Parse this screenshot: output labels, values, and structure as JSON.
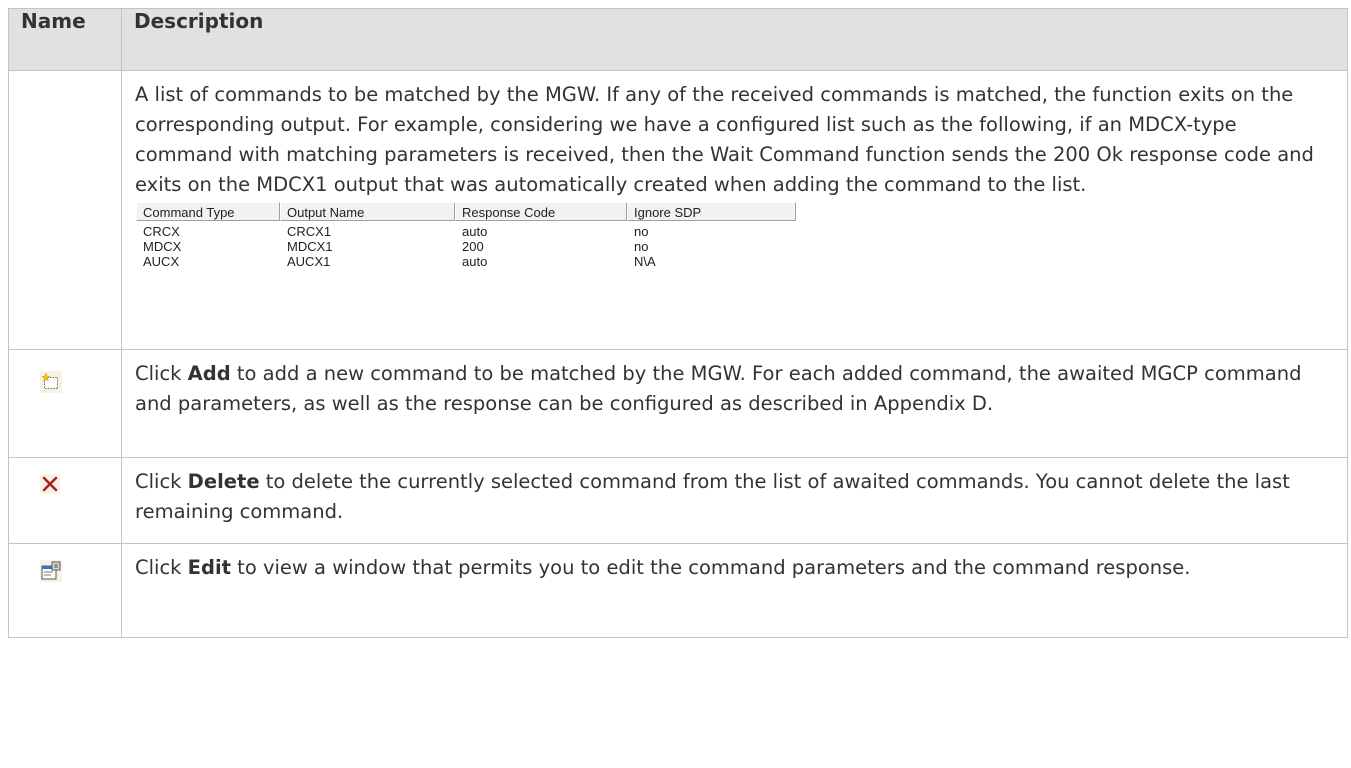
{
  "table": {
    "header": {
      "name": "Name",
      "description": "Description"
    },
    "rows": [
      {
        "text": "A list of commands to be matched by the MGW. If any of the received commands is matched, the function exits on the corresponding output. For example, considering we have a configured list such as the following, if an MDCX-type command with matching parameters is received, then the Wait Command function sends the 200 Ok response code and exits on the MDCX1 output that was automatically created when adding the command to the list."
      },
      {
        "icon": "add-icon",
        "prefix": "Click ",
        "bold": "Add",
        "suffix": " to add a new command to be matched by the MGW. For each added command, the awaited MGCP command and parameters, as well as the response can be configured as described in Appendix D."
      },
      {
        "icon": "delete-icon",
        "prefix": "Click ",
        "bold": "Delete",
        "suffix": " to delete the currently selected command from the list of awaited commands. You cannot delete the last remaining command."
      },
      {
        "icon": "edit-icon",
        "prefix": "Click ",
        "bold": "Edit",
        "suffix": " to view a window that permits you to edit the command parameters and the command response."
      }
    ]
  },
  "command_list": {
    "columns": [
      "Command Type",
      "Output Name",
      "Response Code",
      "Ignore SDP"
    ],
    "rows": [
      [
        "CRCX",
        "CRCX1",
        "auto",
        "no"
      ],
      [
        "MDCX",
        "MDCX1",
        "200",
        "no"
      ],
      [
        "AUCX",
        "AUCX1",
        "auto",
        "N\\A"
      ]
    ]
  },
  "colors": {
    "header_bg": "#e1e1e1",
    "border": "#c4c4c4",
    "text": "#333333",
    "delete_icon": "#b0201c"
  }
}
